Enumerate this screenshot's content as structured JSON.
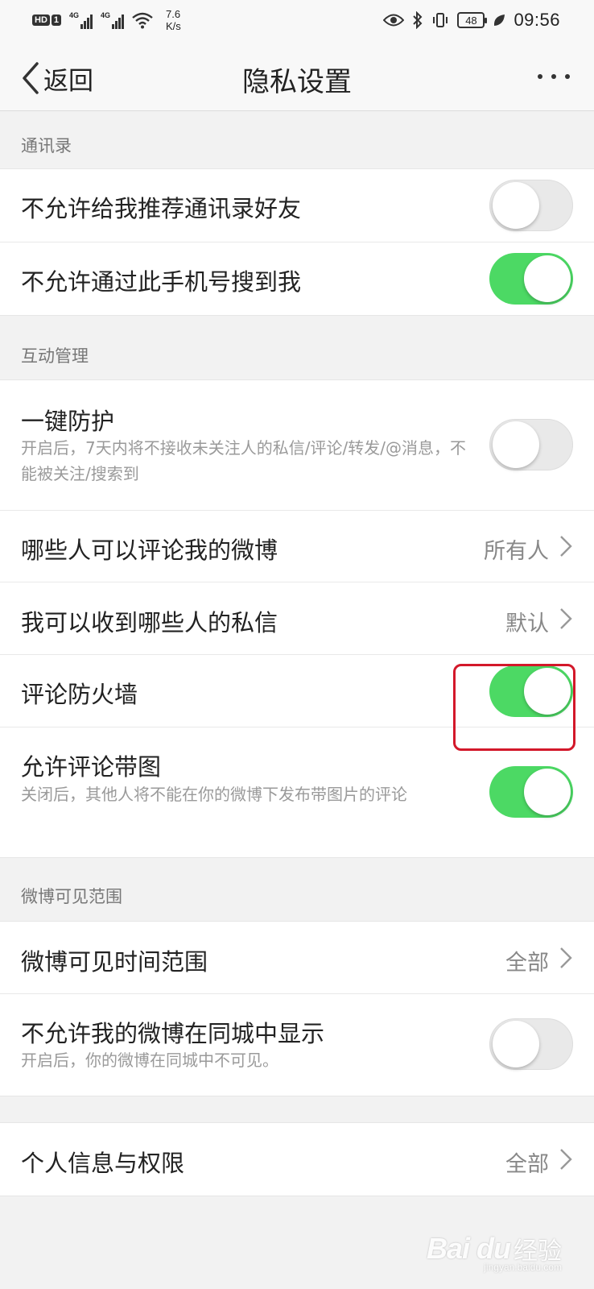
{
  "status_bar": {
    "hd": "HD",
    "sim": "1",
    "signal1_type": "4G",
    "signal2_type": "4G",
    "net_speed_value": "7.6",
    "net_speed_unit": "K/s",
    "battery": "48",
    "time": "09:56",
    "icons": [
      "hd-icon",
      "signal-icon",
      "wifi-icon",
      "eye-icon",
      "bluetooth-icon",
      "vibrate-icon",
      "battery-icon",
      "leaf-icon"
    ]
  },
  "nav": {
    "back_label": "返回",
    "title": "隐私设置",
    "more_icon": "more-dots-icon"
  },
  "sections": {
    "contacts": {
      "header": "通讯录",
      "rows": [
        {
          "title": "不允许给我推荐通讯录好友",
          "toggle": false
        },
        {
          "title": "不允许通过此手机号搜到我",
          "toggle": true
        }
      ]
    },
    "interaction": {
      "header": "互动管理",
      "rows": [
        {
          "title": "一键防护",
          "subtitle": "开启后，7天内将不接收未关注人的私信/评论/转发/@消息，不能被关注/搜索到",
          "toggle": false
        },
        {
          "title": "哪些人可以评论我的微博",
          "value": "所有人"
        },
        {
          "title": "我可以收到哪些人的私信",
          "value": "默认"
        },
        {
          "title": "评论防火墙",
          "toggle": true
        },
        {
          "title": "允许评论带图",
          "subtitle": "关闭后，其他人将不能在你的微博下发布带图片的评论",
          "toggle": true
        }
      ]
    },
    "visibility": {
      "header": "微博可见范围",
      "rows": [
        {
          "title": "微博可见时间范围",
          "value": "全部"
        },
        {
          "title": "不允许我的微博在同城中显示",
          "subtitle": "开启后，你的微博在同城中不可见。",
          "toggle": false
        }
      ]
    },
    "personal": {
      "rows": [
        {
          "title": "个人信息与权限",
          "value": "全部"
        }
      ]
    }
  },
  "colors": {
    "toggle_on": "#4cd964",
    "toggle_off": "#e9e9e9",
    "highlight": "#d3182a",
    "background": "#f2f2f2"
  },
  "watermark": {
    "main": "Bai du",
    "cn": "经验",
    "url": "jingyan.baidu.com"
  }
}
